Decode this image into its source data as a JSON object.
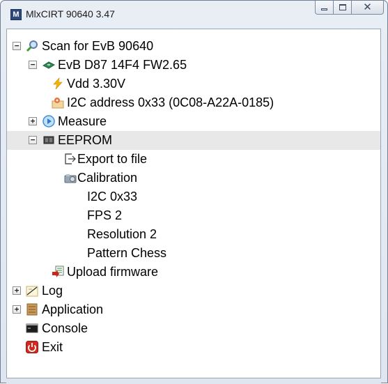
{
  "window": {
    "title": "MlxCIRT 90640 3.47",
    "app_icon_letter": "M",
    "minimize_glyph": "—",
    "close_glyph": "✕"
  },
  "tree": {
    "nodes": [
      {
        "label": "Scan for EvB 90640",
        "icon": "search-icon",
        "expander": "−"
      },
      {
        "label": "EvB D87 14F4 FW2.65",
        "icon": "board-icon",
        "expander": "−"
      },
      {
        "label": "Vdd 3.30V",
        "icon": "lightning-icon"
      },
      {
        "label": "I2C address 0x33 (0C08-A22A-0185)",
        "icon": "map-pin-icon"
      },
      {
        "label": "Measure",
        "icon": "play-icon",
        "expander": "+"
      },
      {
        "label": "EEPROM",
        "icon": "eeprom-icon",
        "expander": "−",
        "selected": true
      },
      {
        "label": "Export to file",
        "icon": "export-icon"
      },
      {
        "label": "Calibration",
        "icon": "calibration-icon"
      },
      {
        "label": "I2C 0x33"
      },
      {
        "label": "FPS 2"
      },
      {
        "label": "Resolution 2"
      },
      {
        "label": "Pattern Chess"
      },
      {
        "label": "Upload firmware",
        "icon": "upload-firmware-icon"
      },
      {
        "label": "Log",
        "icon": "log-icon",
        "expander": "+"
      },
      {
        "label": "Application",
        "icon": "application-icon",
        "expander": "+"
      },
      {
        "label": "Console",
        "icon": "console-icon"
      },
      {
        "label": "Exit",
        "icon": "power-icon"
      }
    ]
  },
  "colors": {
    "title_bar_top": "#e9eef5",
    "selection": "#e8e8e8",
    "lightning": "#f5b400",
    "exit_red": "#d22a1e",
    "board_green": "#2e8b57",
    "play_blue": "#3f8fd8"
  }
}
